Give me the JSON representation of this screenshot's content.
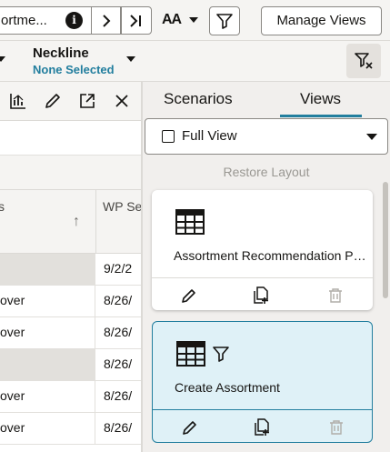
{
  "toolbar": {
    "breadcrumb_title": "ortme...",
    "info_icon": "info-icon",
    "next_icon": "chevron-right-icon",
    "last_icon": "chevron-last-icon",
    "text_size_label": "AA",
    "filter_icon": "filter-icon",
    "manage_views_label": "Manage Views"
  },
  "filter_row": {
    "neckline_label": "Neckline",
    "neckline_value": "None Selected",
    "clear_filter_icon": "clear-filter-icon"
  },
  "grid": {
    "toolbar_icons": [
      "chart-icon",
      "edit-icon",
      "expand-icon",
      "close-icon"
    ],
    "header": {
      "col1": "s",
      "col2": "WP Se",
      "sort_arrow": "↑"
    },
    "rows": [
      {
        "a": "",
        "b": "9/2/2",
        "grey": true
      },
      {
        "a": "over",
        "b": "8/26/",
        "grey": false
      },
      {
        "a": "over",
        "b": "8/26/",
        "grey": false
      },
      {
        "a": "",
        "b": "8/26/",
        "grey": true
      },
      {
        "a": "over",
        "b": "8/26/",
        "grey": false
      },
      {
        "a": "over",
        "b": "8/26/",
        "grey": false
      }
    ]
  },
  "panel": {
    "tabs": [
      {
        "label": "Scenarios",
        "active": false
      },
      {
        "label": "Views",
        "active": true
      }
    ],
    "view_select": {
      "value": "Full View"
    },
    "restore_label": "Restore Layout",
    "cards": [
      {
        "title": "Assortment Recommendation Planning",
        "icon": "table-icon",
        "has_filter": false,
        "selected": false
      },
      {
        "title": "Create Assortment",
        "icon": "table-icon",
        "has_filter": true,
        "selected": true
      }
    ],
    "card_actions": [
      "edit-icon",
      "duplicate-icon",
      "delete-icon"
    ]
  },
  "colors": {
    "accent": "#227e9e",
    "selected_card_bg": "#dff1f7",
    "toolbar_bg": "#f5f4f2",
    "panel_bg": "#f1efed"
  }
}
